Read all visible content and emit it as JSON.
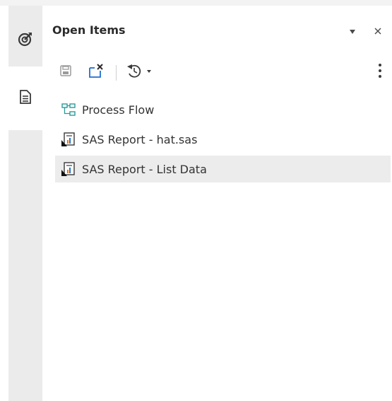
{
  "panel": {
    "title": "Open Items"
  },
  "rail": {
    "tabs": [
      {
        "name": "tasks",
        "icon": "target-arrow-icon"
      },
      {
        "name": "open-items",
        "icon": "document-icon",
        "active": true
      }
    ]
  },
  "toolbar": {
    "buttons": [
      {
        "name": "save",
        "icon": "save-icon"
      },
      {
        "name": "close-all",
        "icon": "close-window-icon"
      },
      {
        "name": "history",
        "icon": "history-icon"
      }
    ]
  },
  "items": [
    {
      "label": "Process Flow",
      "icon": "process-flow-icon",
      "selected": false
    },
    {
      "label": "SAS Report - hat.sas",
      "icon": "sas-report-icon",
      "selected": false
    },
    {
      "label": "SAS Report - List Data",
      "icon": "sas-report-icon",
      "selected": true
    }
  ],
  "colors": {
    "rail_bg": "#ebebeb",
    "selected_bg": "#ececec",
    "accent_blue": "#1f6fd1",
    "flow_teal": "#2a9a9a"
  }
}
